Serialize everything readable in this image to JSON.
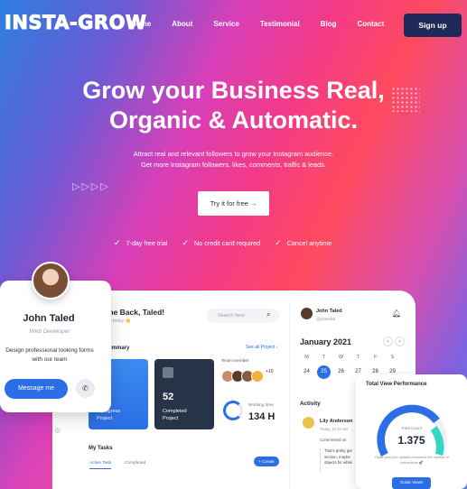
{
  "brand": {
    "logo": "INSTA-GROW"
  },
  "nav": {
    "links": [
      "Home",
      "About",
      "Service",
      "Testimonial",
      "Blog",
      "Contact"
    ],
    "signup": "Sign up"
  },
  "hero": {
    "title_line1": "Grow your Business Real,",
    "title_line2": "Organic & Automatic.",
    "subtitle_line1": "Attract real and relevant followers to grow your Instagram audience.",
    "subtitle_line2": "Get more Instagram followers, likes, comments, traffic & leads.",
    "cta": "Try it for free →",
    "checks": [
      "7-day free trial",
      "No credit card required",
      "Cancel anytime"
    ]
  },
  "dashboard": {
    "welcome": "me Back, Taled!",
    "welcome_sub": "ed today 👋",
    "search_placeholder": "Search here",
    "summary": "ummary",
    "see_all": "See all Project ›",
    "card1": {
      "label_l1": "n progress",
      "label_l2": "Project"
    },
    "card2": {
      "count": "52",
      "label_l1": "Completed",
      "label_l2": "Project"
    },
    "team_label": "Team member",
    "team_more": "+10",
    "working_label": "Working time",
    "working_value": "134 H",
    "tasks_title": "My Tasks",
    "tab_active": "Active Task",
    "tab_completed": "Completed",
    "create": "+ Create",
    "profile_name": "John Taled",
    "profile_role": "@johntaled",
    "month": "January 2021",
    "weekdays": [
      "M",
      "T",
      "W",
      "T",
      "F",
      "S"
    ],
    "dates": [
      "24",
      "25",
      "26",
      "27",
      "28",
      "29"
    ],
    "selected_date": "25",
    "activity_title": "Activity",
    "activity_name": "Lily Anderson",
    "activity_time": "Today, 10:15 AM",
    "activity_comment": "Commented on",
    "activity_quote": "That's pretty gor section, maybe objects for white"
  },
  "performance": {
    "title": "Total View Performance",
    "label": "Total Count",
    "value": "1.375",
    "note": "Raise your info updated tomorrow the number of interactions 🚀",
    "button": "Guide Views",
    "level": 0.72
  },
  "profile_card": {
    "name": "John Taled",
    "role": "Web Developer",
    "desc": "Design professional looking forms with our team",
    "message": "Message me"
  },
  "colors": {
    "accent": "#2b6ee6",
    "signup_bg": "#1d2a5b",
    "dark_card": "#273347"
  }
}
